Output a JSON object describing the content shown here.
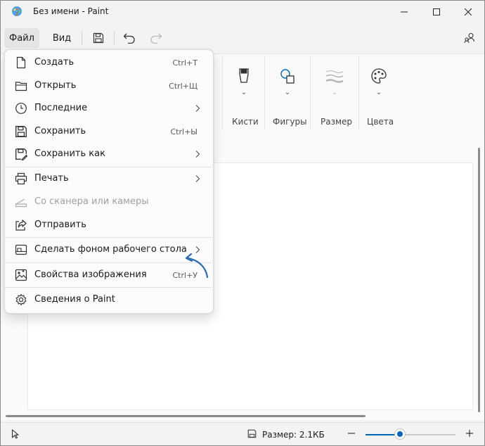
{
  "window": {
    "title": "Без имени - Paint"
  },
  "menubar": {
    "file": "Файл",
    "view": "Вид"
  },
  "ribbon": {
    "groups": [
      {
        "label": "Кисти",
        "icon": "brush-icon"
      },
      {
        "label": "Фигуры",
        "icon": "shapes-icon"
      },
      {
        "label": "Размер",
        "icon": "size-icon"
      },
      {
        "label": "Цвета",
        "icon": "palette-icon"
      }
    ]
  },
  "file_menu": {
    "items": [
      {
        "label": "Создать",
        "shortcut": "Ctrl+T",
        "icon": "new-file-icon"
      },
      {
        "label": "Открыть",
        "shortcut": "Ctrl+Щ",
        "icon": "folder-icon"
      },
      {
        "label": "Последние",
        "shortcut": "",
        "icon": "clock-icon",
        "submenu": true
      },
      {
        "label": "Сохранить",
        "shortcut": "Ctrl+Ы",
        "icon": "save-icon"
      },
      {
        "label": "Сохранить как",
        "shortcut": "",
        "icon": "save-as-icon",
        "submenu": true
      },
      {
        "label": "Печать",
        "shortcut": "",
        "icon": "printer-icon",
        "submenu": true
      },
      {
        "label": "Со сканера или камеры",
        "shortcut": "",
        "icon": "scanner-icon",
        "disabled": true
      },
      {
        "label": "Отправить",
        "shortcut": "",
        "icon": "share-icon"
      },
      {
        "label": "Сделать фоном рабочего стола",
        "shortcut": "",
        "icon": "wallpaper-icon",
        "submenu": true
      },
      {
        "label": "Свойства изображения",
        "shortcut": "Ctrl+У",
        "icon": "image-properties-icon"
      },
      {
        "label": "Сведения о Paint",
        "shortcut": "",
        "icon": "gear-icon"
      }
    ]
  },
  "status_bar": {
    "size_text": "Размер: 2.1КБ",
    "zoom_fraction": 0.38
  },
  "colors": {
    "accent": "#0067c0",
    "annotation_arrow": "#2b6db5"
  }
}
